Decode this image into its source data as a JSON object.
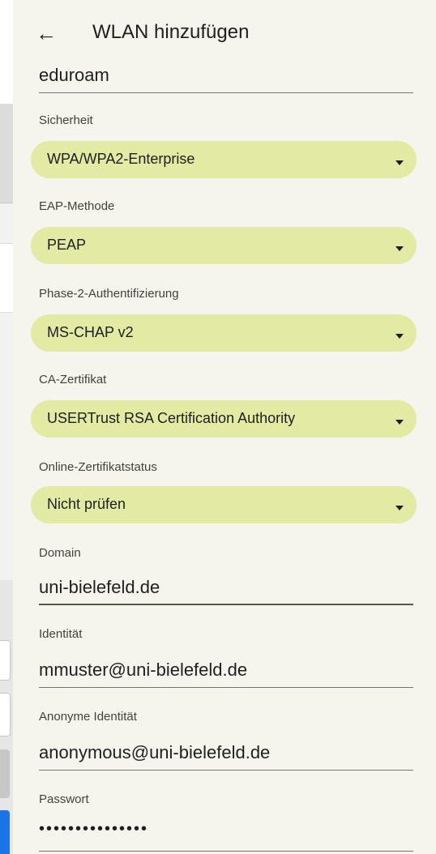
{
  "header": {
    "title": "WLAN hinzufügen",
    "back_icon": "arrow-back-icon"
  },
  "network_name": "eduroam",
  "security": {
    "label": "Sicherheit",
    "value": "WPA/WPA2-Enterprise"
  },
  "eap": {
    "label": "EAP-Methode",
    "value": "PEAP"
  },
  "phase2": {
    "label": "Phase-2-Authentifizierung",
    "value": "MS-CHAP v2"
  },
  "ca": {
    "label": "CA-Zertifikat",
    "value": "USERTrust RSA Certification Authority"
  },
  "ocsp": {
    "label": "Online-Zertifikatstatus",
    "value": "Nicht prüfen"
  },
  "domain": {
    "label": "Domain",
    "value": "uni-bielefeld.de"
  },
  "identity": {
    "label": "Identität",
    "value": "mmuster@uni-bielefeld.de"
  },
  "anon_identity": {
    "label": "Anonyme Identität",
    "value": "anonymous@uni-bielefeld.de"
  },
  "password": {
    "label": "Passwort",
    "value": "•••••••••••••••"
  },
  "colors": {
    "background": "#f5f5ee",
    "dropdown": "#e2eaa4",
    "text": "#1f1f1f"
  }
}
